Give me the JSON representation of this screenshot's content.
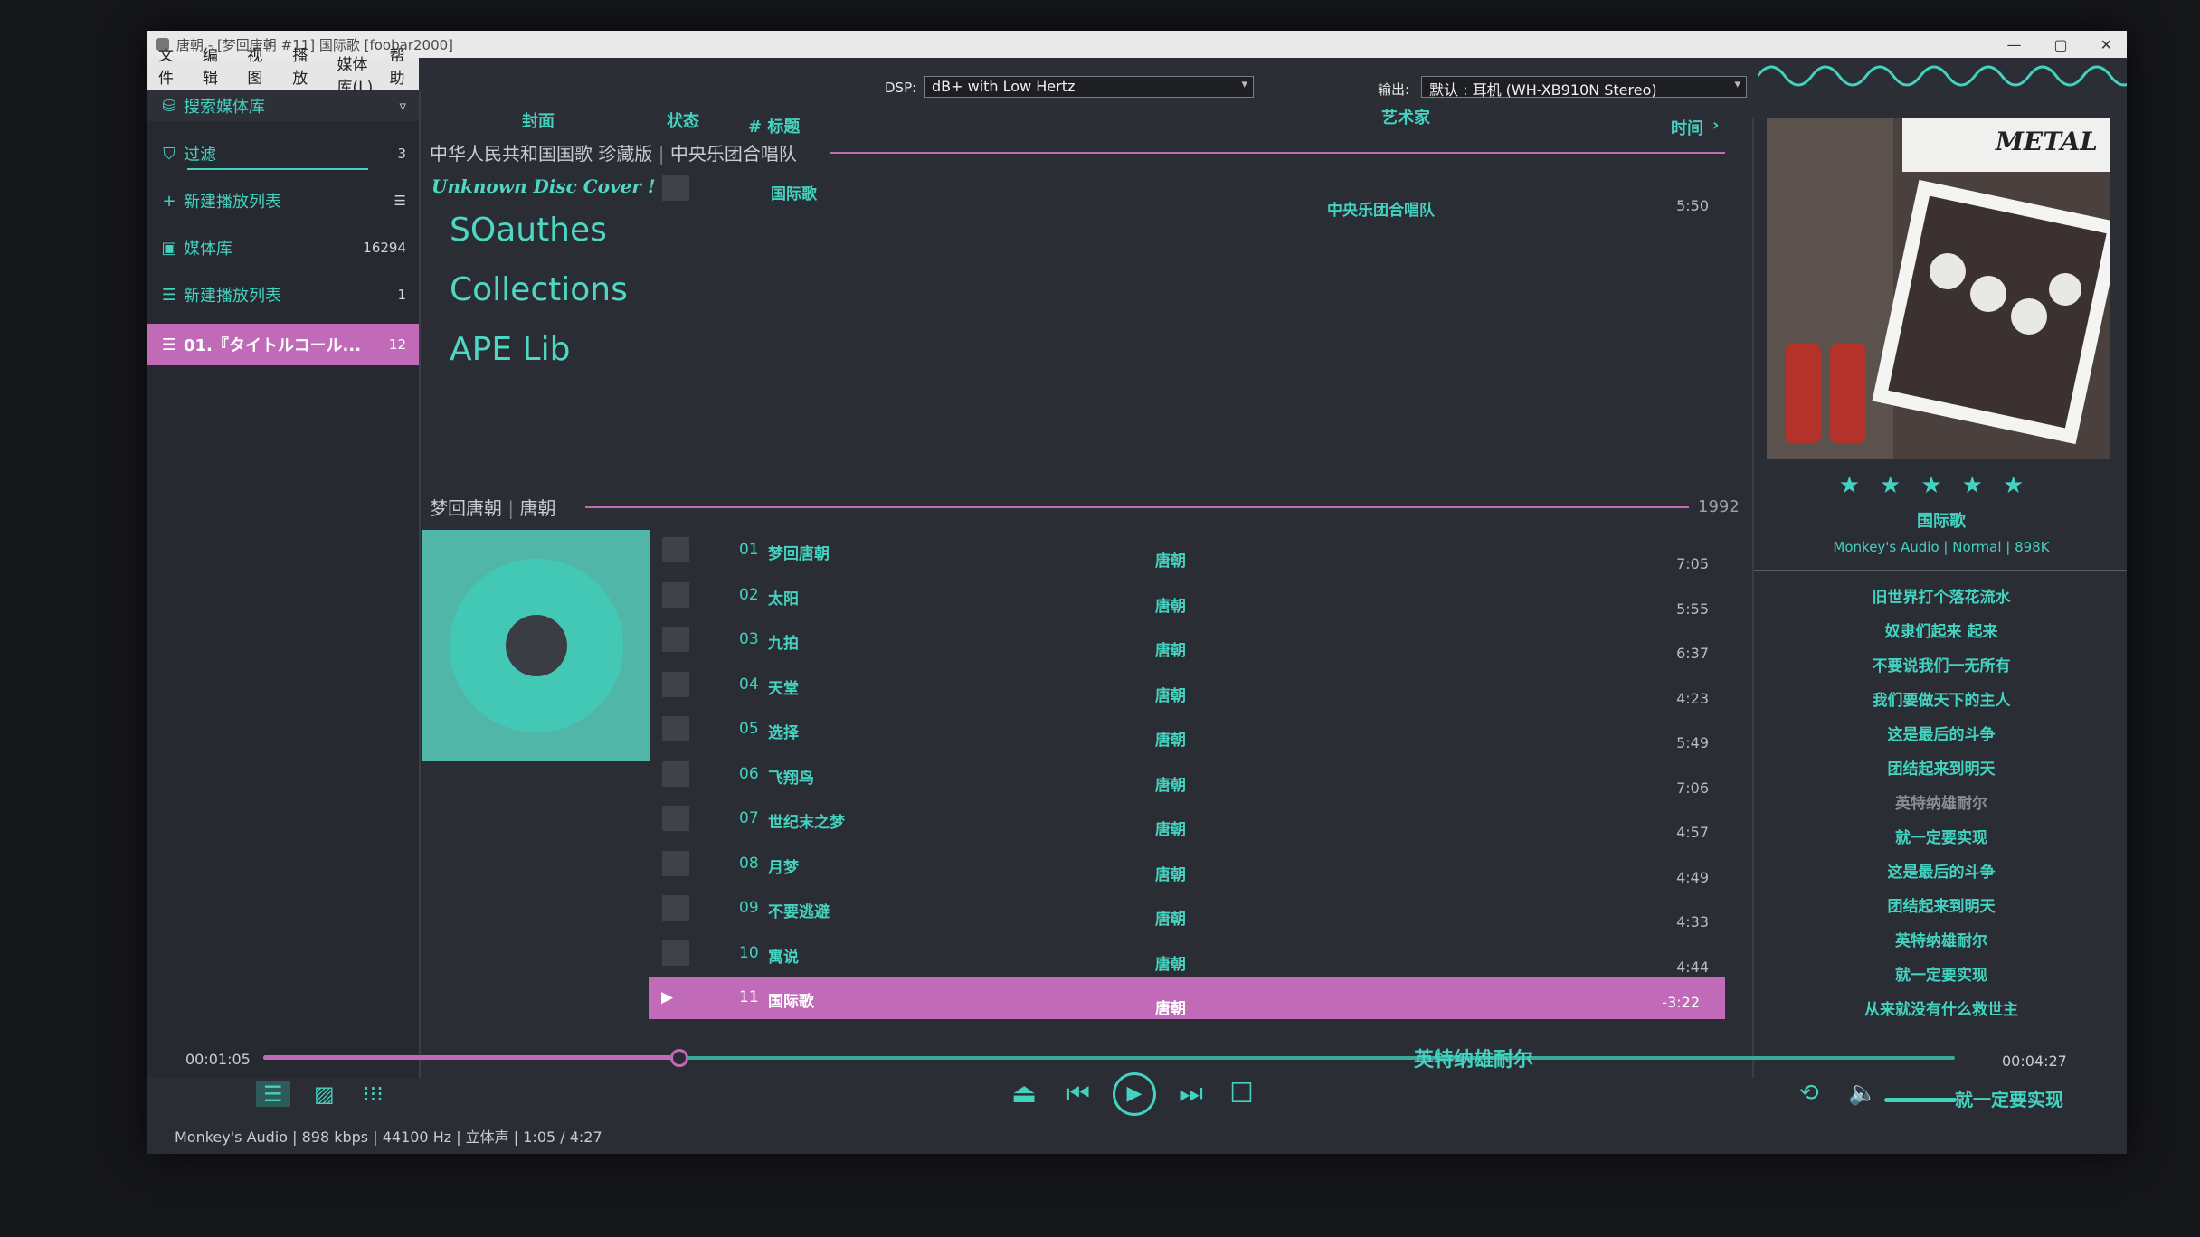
{
  "window": {
    "title": "唐朝 - [梦回唐朝 #11] 国际歌  [foobar2000]"
  },
  "menu": [
    "文件(F)",
    "编辑(E)",
    "视图(V)",
    "播放(P)",
    "媒体库(L)",
    "帮助(H)"
  ],
  "dsp": {
    "label": "DSP:",
    "value": "dB+ with Low Hertz"
  },
  "output": {
    "label": "输出:",
    "value": "默认 : 耳机 (WH-XB910N Stereo)"
  },
  "sidebar": {
    "search": "搜索媒体库",
    "items": [
      {
        "label": "过滤",
        "count": "3"
      },
      {
        "label": "新建播放列表",
        "count": ""
      },
      {
        "label": "媒体库",
        "count": "16294"
      },
      {
        "label": "新建播放列表",
        "count": "1"
      },
      {
        "label": "01.『タイトルコール...",
        "count": "12"
      }
    ]
  },
  "columns": {
    "cover": "封面",
    "status": "状态",
    "num_title": "# 标题",
    "artist": "艺术家",
    "time": "时间"
  },
  "group1": {
    "album": "中华人民共和国国歌 珍藏版",
    "artist": "中央乐团合唱队",
    "disc_cover": "Unknown Disc Cover !",
    "cover_lines": [
      "SOauthes",
      "Collections",
      "APE Lib"
    ],
    "track": {
      "title": "国际歌",
      "artist": "中央乐团合唱队",
      "duration": "5:50"
    }
  },
  "group2": {
    "album": "梦回唐朝",
    "artist": "唐朝",
    "year": "1992",
    "tracks": [
      {
        "num": "01",
        "title": "梦回唐朝",
        "artist": "唐朝",
        "duration": "7:05"
      },
      {
        "num": "02",
        "title": "太阳",
        "artist": "唐朝",
        "duration": "5:55"
      },
      {
        "num": "03",
        "title": "九拍",
        "artist": "唐朝",
        "duration": "6:37"
      },
      {
        "num": "04",
        "title": "天堂",
        "artist": "唐朝",
        "duration": "4:23"
      },
      {
        "num": "05",
        "title": "选择",
        "artist": "唐朝",
        "duration": "5:49"
      },
      {
        "num": "06",
        "title": "飞翔鸟",
        "artist": "唐朝",
        "duration": "7:06"
      },
      {
        "num": "07",
        "title": "世纪末之梦",
        "artist": "唐朝",
        "duration": "4:57"
      },
      {
        "num": "08",
        "title": "月梦",
        "artist": "唐朝",
        "duration": "4:49"
      },
      {
        "num": "09",
        "title": "不要逃避",
        "artist": "唐朝",
        "duration": "4:33"
      },
      {
        "num": "10",
        "title": "寓说",
        "artist": "唐朝",
        "duration": "4:44"
      },
      {
        "num": "11",
        "title": "国际歌",
        "artist": "唐朝",
        "duration": "-3:22",
        "playing": true
      }
    ]
  },
  "nowplaying": {
    "art_text": "METAL",
    "rating_stars": 5,
    "title": "国际歌",
    "meta": "Monkey's Audio | Normal | 898K"
  },
  "lyrics": [
    "旧世界打个落花流水",
    "奴隶们起来 起来",
    "不要说我们一无所有",
    "我们要做天下的主人",
    "这是最后的斗争",
    "团结起来到明天",
    "英特纳雄耐尔",
    "就一定要实现",
    "这是最后的斗争",
    "团结起来到明天",
    "英特纳雄耐尔",
    "就一定要实现",
    "从来就没有什么救世主"
  ],
  "playback": {
    "elapsed": "00:01:05",
    "total": "00:04:27",
    "progress": 0.245,
    "seek_lyric": "英特纳雄耐尔",
    "vol_lyric": "就一定要实现",
    "status": "Monkey's Audio | 898 kbps | 44100 Hz | 立体声 | 1:05 / 4:27"
  },
  "colors": {
    "accent_teal": "#44d2c0",
    "accent_pink": "#c06ab8",
    "bg": "#2a2d33"
  },
  "icons": [
    "filter-icon",
    "plus-icon",
    "library-icon",
    "playlist-icon",
    "eject-icon",
    "prev-icon",
    "play-icon",
    "next-icon",
    "stop-icon",
    "repeat-icon",
    "volume-icon"
  ]
}
